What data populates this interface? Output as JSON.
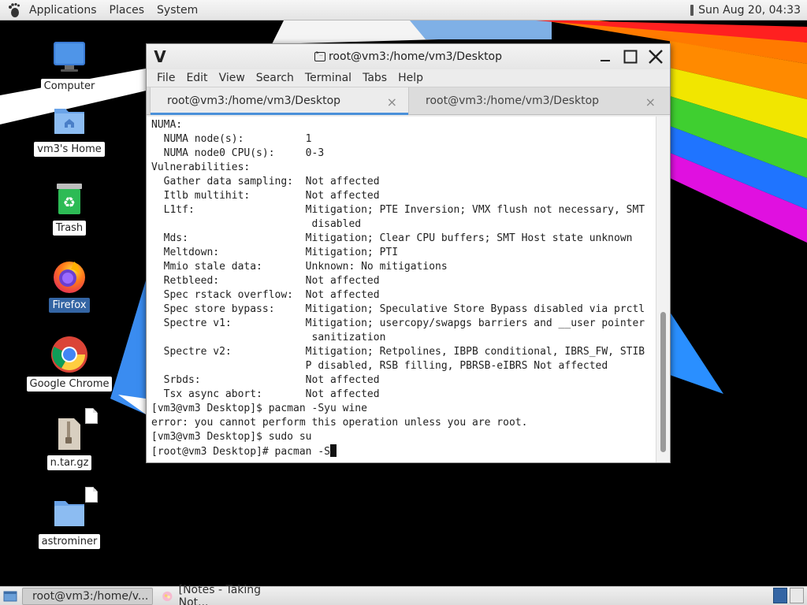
{
  "top_panel": {
    "menus": [
      "Applications",
      "Places",
      "System"
    ],
    "clock": "Sun Aug 20, 04:33"
  },
  "desktop_icons": [
    {
      "label": "Computer",
      "icon": "computer-icon"
    },
    {
      "label": "vm3's Home",
      "icon": "home-folder-icon"
    },
    {
      "label": "Trash",
      "icon": "trash-icon"
    },
    {
      "label": "Firefox",
      "icon": "firefox-icon",
      "selected": true
    },
    {
      "label": "Google Chrome",
      "icon": "chrome-icon"
    },
    {
      "label": "n.tar.gz",
      "icon": "archive-icon"
    },
    {
      "label": "astrominer",
      "icon": "folder-icon"
    }
  ],
  "window": {
    "title": "root@vm3:/home/vm3/Desktop",
    "menu": [
      "File",
      "Edit",
      "View",
      "Search",
      "Terminal",
      "Tabs",
      "Help"
    ],
    "tabs": [
      {
        "label": "root@vm3:/home/vm3/Desktop",
        "active": true
      },
      {
        "label": "root@vm3:/home/vm3/Desktop",
        "active": false
      }
    ],
    "tab_close_glyph": "×"
  },
  "terminal": {
    "lines": [
      "NUMA:",
      "  NUMA node(s):          1",
      "  NUMA node0 CPU(s):     0-3",
      "Vulnerabilities:",
      "  Gather data sampling:  Not affected",
      "  Itlb multihit:         Not affected",
      "  L1tf:                  Mitigation; PTE Inversion; VMX flush not necessary, SMT",
      "                          disabled",
      "  Mds:                   Mitigation; Clear CPU buffers; SMT Host state unknown",
      "  Meltdown:              Mitigation; PTI",
      "  Mmio stale data:       Unknown: No mitigations",
      "  Retbleed:              Not affected",
      "  Spec rstack overflow:  Not affected",
      "  Spec store bypass:     Mitigation; Speculative Store Bypass disabled via prctl",
      "  Spectre v1:            Mitigation; usercopy/swapgs barriers and __user pointer",
      "                          sanitization",
      "  Spectre v2:            Mitigation; Retpolines, IBPB conditional, IBRS_FW, STIB",
      "                         P disabled, RSB filling, PBRSB-eIBRS Not affected",
      "  Srbds:                 Not affected",
      "  Tsx async abort:       Not affected",
      "[vm3@vm3 Desktop]$ pacman -Syu wine",
      "error: you cannot perform this operation unless you are root.",
      "[vm3@vm3 Desktop]$ sudo su"
    ],
    "prompt_line": "[root@vm3 Desktop]# pacman -S"
  },
  "taskbar": {
    "tasks": [
      {
        "label": "root@vm3:/home/v...",
        "active": true
      },
      {
        "label": "[Notes - Taking Not...",
        "active": false
      }
    ],
    "workspaces": 2,
    "active_workspace": 1
  },
  "colors": {
    "panel_bg": "#e4e4e4",
    "selection": "#3465a4",
    "tab_underline": "#4a90d9",
    "terminal_bg": "#ffffff",
    "terminal_fg": "#222222"
  }
}
